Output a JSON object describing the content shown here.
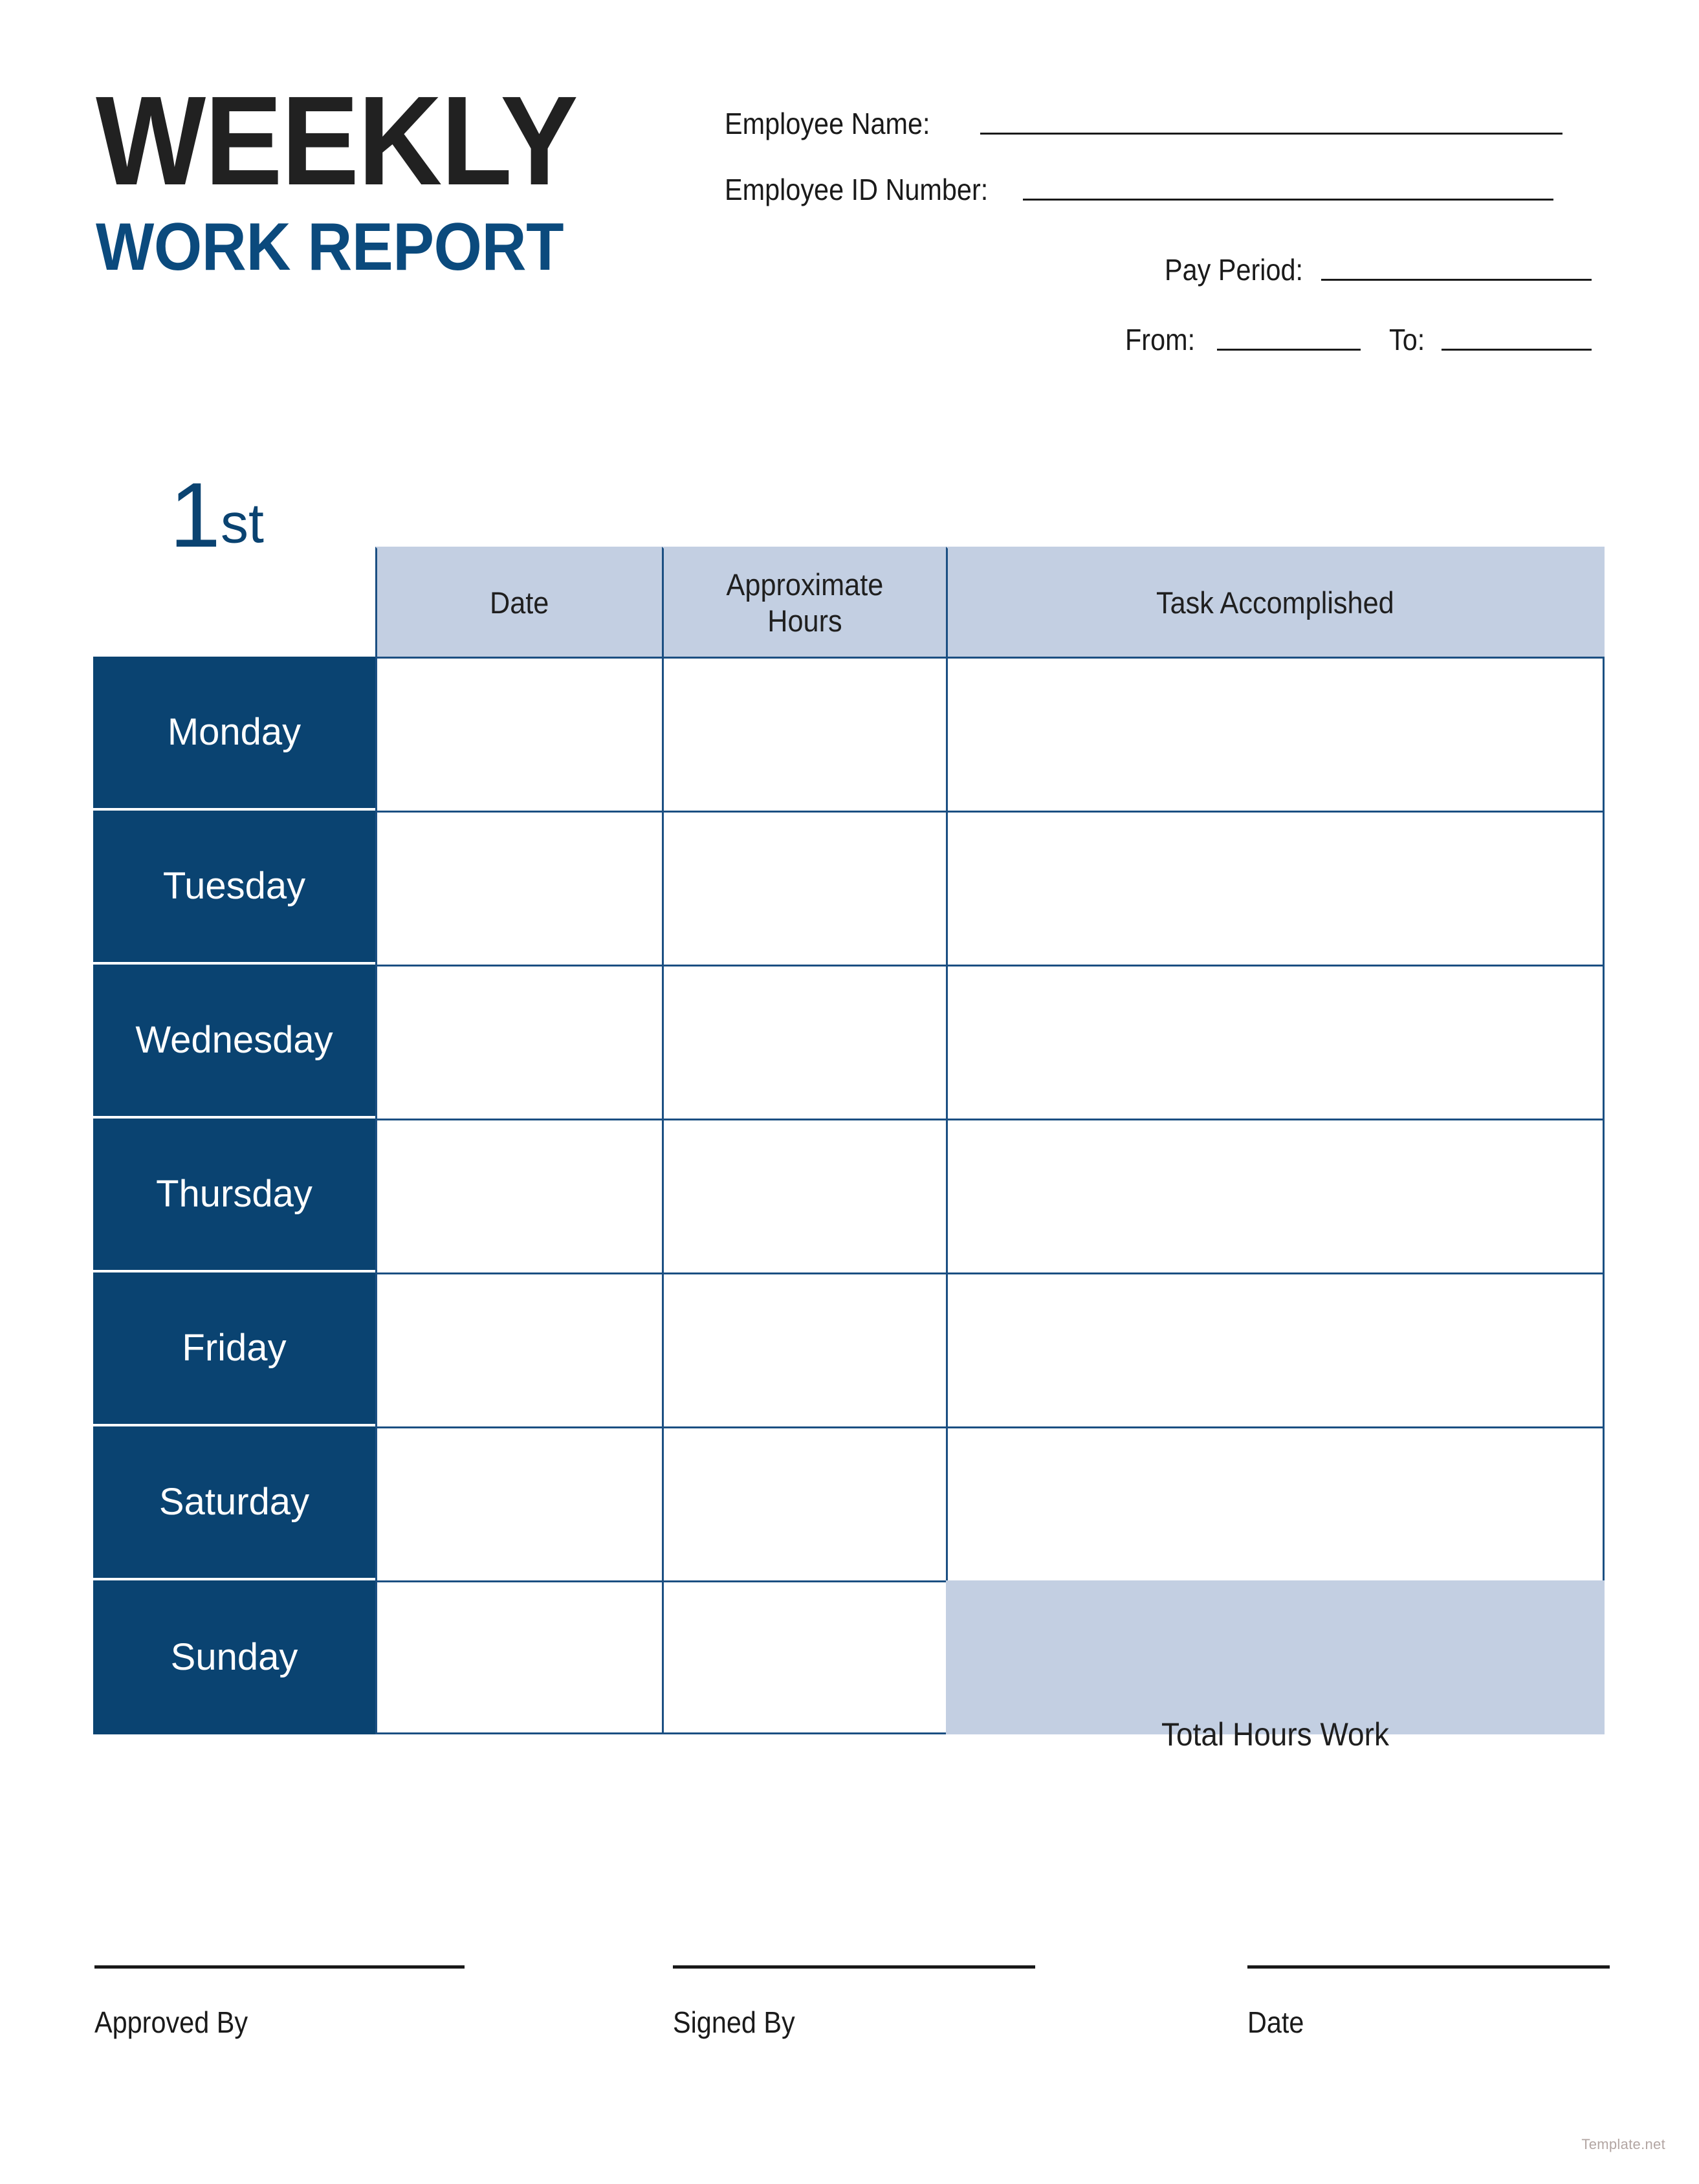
{
  "document": {
    "title_main": "WEEKLY",
    "title_sub": "WORK REPORT",
    "week_ordinal_number": "1",
    "week_ordinal_suffix": "st",
    "watermark": "Template.net"
  },
  "colors": {
    "navy_dark": "#0a4371",
    "navy_title": "#0b4a7d",
    "header_fill": "#c3cfe2",
    "border_blue": "#1b4f82",
    "text_black": "#1f1f1f",
    "watermark": "#b3a6a3"
  },
  "form": {
    "employee_name_label": "Employee Name:",
    "employee_id_label": "Employee ID Number:",
    "pay_period_label": "Pay Period:",
    "from_label": "From:",
    "to_label": "To:",
    "employee_name_value": "",
    "employee_id_value": "",
    "pay_period_value": "",
    "from_value": "",
    "to_value": ""
  },
  "table": {
    "columns": [
      "",
      "Date",
      "Approximate",
      "Hours",
      "Task Accomplished"
    ],
    "headers": {
      "day": "",
      "date": "Date",
      "hours_line1": "Approximate",
      "hours_line2": "Hours",
      "task": "Task Accomplished"
    },
    "rows": [
      {
        "day": "Monday",
        "date": "",
        "hours": "",
        "task": ""
      },
      {
        "day": "Tuesday",
        "date": "",
        "hours": "",
        "task": ""
      },
      {
        "day": "Wednesday",
        "date": "",
        "hours": "",
        "task": ""
      },
      {
        "day": "Thursday",
        "date": "",
        "hours": "",
        "task": ""
      },
      {
        "day": "Friday",
        "date": "",
        "hours": "",
        "task": ""
      },
      {
        "day": "Saturday",
        "date": "",
        "hours": "",
        "task": ""
      },
      {
        "day": "Sunday",
        "date": "",
        "hours": "",
        "task": ""
      }
    ],
    "total_hours_label": "Total Hours Work",
    "total_hours_value": ""
  },
  "signatures": {
    "approved_by_label": "Approved By",
    "signed_by_label": "Signed By",
    "date_label": "Date",
    "approved_by_value": "",
    "signed_by_value": "",
    "date_value": ""
  }
}
